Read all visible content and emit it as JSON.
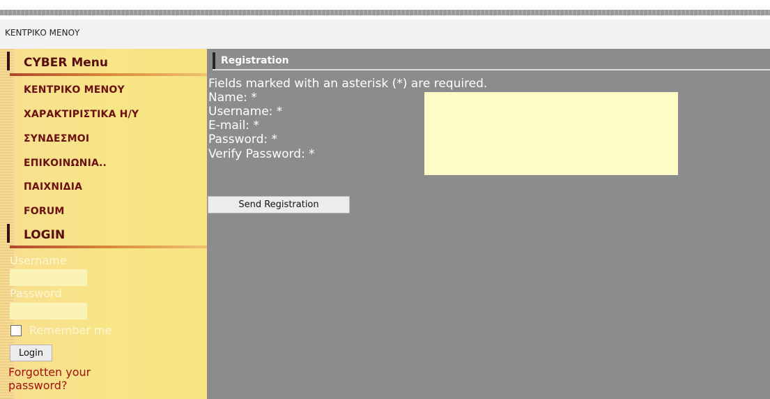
{
  "breadcrumb": "ΚΕΝΤΡΙΚΟ ΜΕΝΟΥ",
  "sidebar": {
    "menu_title": "CYBER Menu",
    "items": [
      {
        "label": "ΚΕΝΤΡΙΚΟ ΜΕΝΟΥ"
      },
      {
        "label": "ΧΑΡΑΚΤΙΡΙΣΤΙΚΑ Η/Υ"
      },
      {
        "label": "ΣΥΝΔΕΣΜΟΙ"
      },
      {
        "label": "ΕΠΙΚΟΙΝΩΝΙΑ.."
      },
      {
        "label": "ΠΑΙΧΝΙΔΙΑ"
      },
      {
        "label": "FORUM"
      }
    ],
    "login_title": "LOGIN",
    "login": {
      "username_label": "Username",
      "password_label": "Password",
      "remember_label": "Remember me",
      "login_button": "Login",
      "forgot_link": "Forgotten your password?"
    }
  },
  "registration": {
    "title": "Registration",
    "notice": "Fields marked with an asterisk (*) are required.",
    "fields": [
      {
        "label": "Name: *"
      },
      {
        "label": "Username: *"
      },
      {
        "label": "E-mail: *"
      },
      {
        "label": "Password: *"
      },
      {
        "label": "Verify Password: *"
      }
    ],
    "submit_label": "Send Registration"
  }
}
